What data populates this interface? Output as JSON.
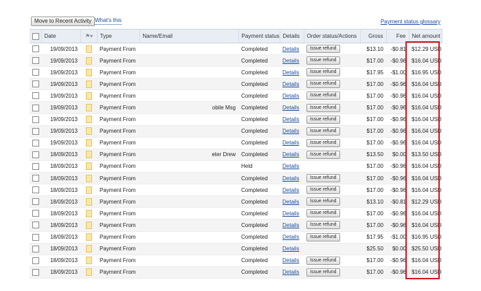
{
  "toolbar": {
    "move_label": "Move to Recent Activity",
    "whats_this": "What's this",
    "glossary": "Payment status glossary"
  },
  "columns": {
    "date": "Date",
    "type": "Type",
    "name": "Name/Email",
    "status": "Payment status",
    "details": "Details",
    "order": "Order status/Actions",
    "gross": "Gross",
    "fee": "Fee",
    "net": "Net amount"
  },
  "icons": {
    "flag": "flag-icon",
    "note": "note-icon"
  },
  "highlight_color": "#d9131a",
  "rows": [
    {
      "date": "19/09/2013",
      "type": "Payment From",
      "name": "",
      "status": "Completed",
      "details": "Details",
      "action": "Issue refund",
      "gross": "$13.10",
      "fee": "-$0.81",
      "net": "$12.29 USD"
    },
    {
      "date": "19/09/2013",
      "type": "Payment From",
      "name": "",
      "status": "Completed",
      "details": "Details",
      "action": "Issue refund",
      "gross": "$17.00",
      "fee": "-$0.96",
      "net": "$16.04 USD"
    },
    {
      "date": "19/09/2013",
      "type": "Payment From",
      "name": "",
      "status": "Completed",
      "details": "Details",
      "action": "Issue refund",
      "gross": "$17.95",
      "fee": "-$1.00",
      "net": "$16.95 USD"
    },
    {
      "date": "19/09/2013",
      "type": "Payment From",
      "name": "",
      "status": "Completed",
      "details": "Details",
      "action": "Issue refund",
      "gross": "$17.00",
      "fee": "-$0.96",
      "net": "$16.04 USD"
    },
    {
      "date": "19/09/2013",
      "type": "Payment From",
      "name": "",
      "status": "Completed",
      "details": "Details",
      "action": "Issue refund",
      "gross": "$17.00",
      "fee": "-$0.96",
      "net": "$16.04 USD"
    },
    {
      "date": "19/09/2013",
      "type": "Payment From",
      "name": "obile Msg",
      "status": "Completed",
      "details": "Details",
      "action": "Issue refund",
      "gross": "$17.00",
      "fee": "-$0.96",
      "net": "$16.04 USD"
    },
    {
      "date": "19/09/2013",
      "type": "Payment From",
      "name": "",
      "status": "Completed",
      "details": "Details",
      "action": "Issue refund",
      "gross": "$17.00",
      "fee": "-$0.96",
      "net": "$16.04 USD"
    },
    {
      "date": "19/09/2013",
      "type": "Payment From",
      "name": "",
      "status": "Completed",
      "details": "Details",
      "action": "Issue refund",
      "gross": "$17.00",
      "fee": "-$0.96",
      "net": "$16.04 USD"
    },
    {
      "date": "19/09/2013",
      "type": "Payment From",
      "name": "",
      "status": "Completed",
      "details": "Details",
      "action": "Issue refund",
      "gross": "$17.00",
      "fee": "-$0.96",
      "net": "$16.04 USD"
    },
    {
      "date": "18/09/2013",
      "type": "Payment From",
      "name": "eter Drew",
      "status": "Completed",
      "details": "Details",
      "action": "Issue refund",
      "gross": "$13.50",
      "fee": "$0.00",
      "net": "$13.50 USD"
    },
    {
      "date": "18/09/2013",
      "type": "Payment From",
      "name": "",
      "status": "Held",
      "details": "Details",
      "action": "",
      "gross": "$17.00",
      "fee": "-$0.96",
      "net": "$16.04 USD"
    },
    {
      "date": "18/09/2013",
      "type": "Payment From",
      "name": "",
      "status": "Completed",
      "details": "Details",
      "action": "Issue refund",
      "gross": "$17.00",
      "fee": "-$0.96",
      "net": "$16.04 USD"
    },
    {
      "date": "18/09/2013",
      "type": "Payment From",
      "name": "",
      "status": "Completed",
      "details": "Details",
      "action": "Issue refund",
      "gross": "$17.00",
      "fee": "-$0.96",
      "net": "$16.04 USD"
    },
    {
      "date": "18/09/2013",
      "type": "Payment From",
      "name": "",
      "status": "Completed",
      "details": "Details",
      "action": "Issue refund",
      "gross": "$13.10",
      "fee": "-$0.81",
      "net": "$12.29 USD"
    },
    {
      "date": "18/09/2013",
      "type": "Payment From",
      "name": "",
      "status": "Completed",
      "details": "Details",
      "action": "Issue refund",
      "gross": "$17.00",
      "fee": "-$0.96",
      "net": "$16.04 USD"
    },
    {
      "date": "18/09/2013",
      "type": "Payment From",
      "name": "",
      "status": "Completed",
      "details": "Details",
      "action": "Issue refund",
      "gross": "$17.00",
      "fee": "-$0.96",
      "net": "$16.04 USD"
    },
    {
      "date": "18/09/2013",
      "type": "Payment From",
      "name": "",
      "status": "Completed",
      "details": "Details",
      "action": "Issue refund",
      "gross": "$17.95",
      "fee": "-$1.00",
      "net": "$16.95 USD"
    },
    {
      "date": "18/09/2013",
      "type": "Payment From",
      "name": "",
      "status": "Completed",
      "details": "Details",
      "action": "",
      "gross": "$25.50",
      "fee": "$0.00",
      "net": "$25.50 USD"
    },
    {
      "date": "18/09/2013",
      "type": "Payment From",
      "name": "",
      "status": "Completed",
      "details": "Details",
      "action": "Issue refund",
      "gross": "$17.00",
      "fee": "-$0.96",
      "net": "$16.04 USD"
    },
    {
      "date": "18/09/2013",
      "type": "Payment From",
      "name": "",
      "status": "Completed",
      "details": "Details",
      "action": "Issue refund",
      "gross": "$17.00",
      "fee": "-$0.96",
      "net": "$16.04 USD"
    }
  ]
}
